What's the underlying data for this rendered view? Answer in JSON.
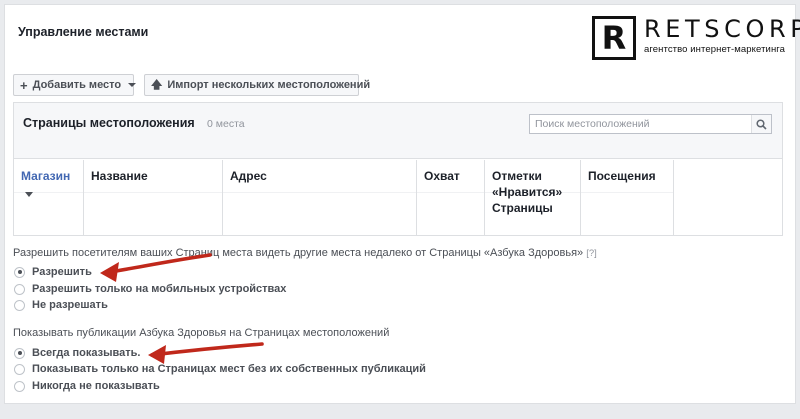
{
  "page": {
    "title": "Управление местами"
  },
  "logo": {
    "letter": "R",
    "name": "RETSCORP",
    "tagline": "агентство интернет-маркетинга"
  },
  "toolbar": {
    "add_label": "Добавить место",
    "import_label": "Импорт нескольких местоположений"
  },
  "panel": {
    "title": "Страницы местоположения",
    "count": "0 места",
    "search_placeholder": "Поиск местоположений"
  },
  "table": {
    "columns": [
      "Магазин",
      "Название",
      "Адрес",
      "Охват",
      "Отметки «Нравится» Страницы",
      "Посещения"
    ]
  },
  "settings": {
    "q1": {
      "text": "Разрешить посетителям ваших Страниц места видеть другие места недалеко от Страницы «Азбука Здоровья»",
      "help": "[?]",
      "options": [
        "Разрешить",
        "Разрешить только на мобильных устройствах",
        "Не разрешать"
      ],
      "selected": 0
    },
    "q2": {
      "text": "Показывать публикации Азбука Здоровья на Страницах местоположений",
      "options": [
        "Всегда показывать.",
        "Показывать только на Страницах мест без их собственных публикаций",
        "Никогда не показывать"
      ],
      "selected": 0
    }
  },
  "colors": {
    "accent": "#4267b2",
    "annotation_arrow": "#c0281b"
  }
}
